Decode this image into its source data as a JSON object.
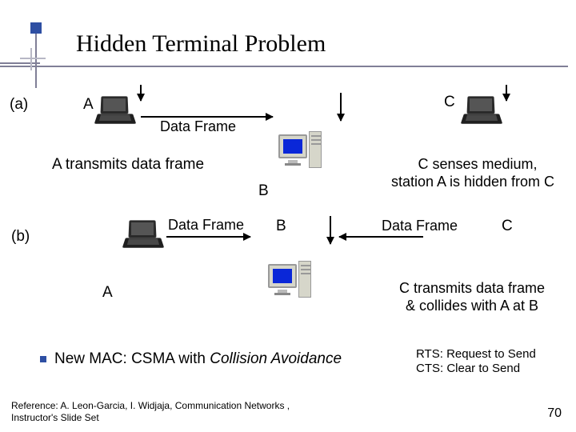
{
  "title": "Hidden Terminal Problem",
  "a": {
    "tag": "(a)",
    "labelA": "A",
    "labelB": "B",
    "labelC": "C",
    "dataFrame": "Data Frame",
    "leftCaption": "A transmits data frame",
    "rightCaption1": "C senses medium,",
    "rightCaption2": "station A is hidden from C"
  },
  "b": {
    "tag": "(b)",
    "labelA": "A",
    "labelB": "B",
    "labelC": "C",
    "dataFrame1": "Data Frame",
    "dataFrame2": "Data Frame",
    "rightCaption1": "C transmits data frame",
    "rightCaption2": "& collides with A at B"
  },
  "bullet": {
    "text": "New MAC:  CSMA with ",
    "italic": "Collision Avoidance"
  },
  "rts": "RTS: Request to Send",
  "cts": "CTS: Clear to Send",
  "reference": "Reference: A. Leon-Garcia, I. Widjaja, Communication Networks , Instructor's Slide Set",
  "page": "70"
}
